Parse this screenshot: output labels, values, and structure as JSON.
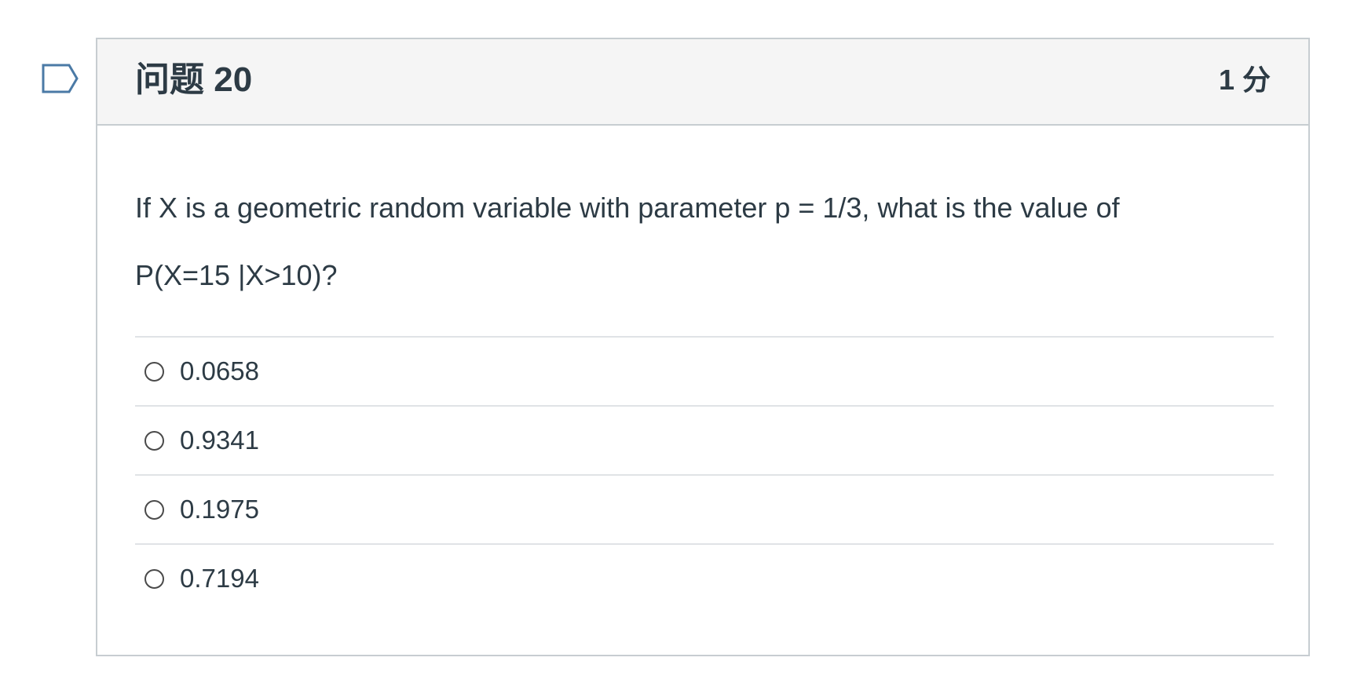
{
  "question": {
    "title": "问题 20",
    "points": "1 分",
    "text_line1": "If X is a geometric random variable with parameter p = 1/3, what is the value of",
    "text_line2": "P(X=15 |X>10)?"
  },
  "answers": [
    {
      "label": "0.0658",
      "selected": false
    },
    {
      "label": "0.9341",
      "selected": false
    },
    {
      "label": "0.1975",
      "selected": false
    },
    {
      "label": "0.7194",
      "selected": false
    }
  ],
  "icons": {
    "flag": "flag-outline-icon"
  },
  "colors": {
    "header_bg": "#f5f5f5",
    "border": "#c7cdd1",
    "text": "#2d3b45",
    "flag": "#4b7aa6"
  }
}
